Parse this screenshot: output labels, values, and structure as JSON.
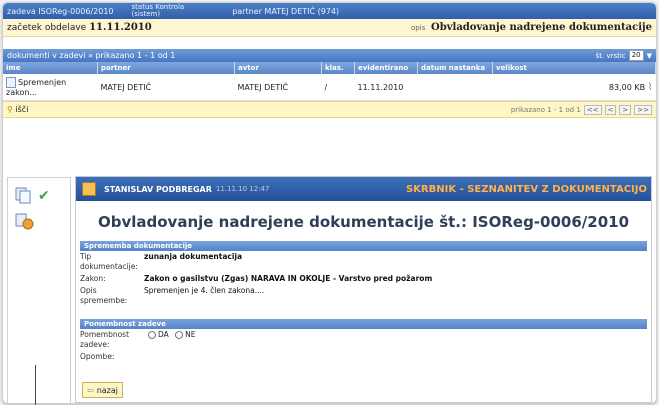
{
  "topbar": {
    "record": "zadeva ISOReg-0006/2010",
    "status_label": "status Kontrola",
    "status_value": "(sistem)",
    "partner": "partner MATEJ DETIČ (974)"
  },
  "title_row": {
    "start_label": "začetek obdelave",
    "start_date": "11.11.2010",
    "desc_label": "opis",
    "desc_value": "Obvladovanje nadrejene dokumentacije"
  },
  "list_header": {
    "title": "dokumenti v zadevi » prikazano 1 - 1 od 1",
    "rows_label": "št. vrstic",
    "rows_value": "20"
  },
  "columns": [
    "ime",
    "partner",
    "avtor",
    "klas.",
    "evidentirano",
    "datum nastanka",
    "velikost"
  ],
  "rows": [
    {
      "name_line1": "Spremenjen",
      "name_line2": "zakon...",
      "partner": "MATEJ DETIČ",
      "author": "MATEJ DETIČ",
      "klas": "/",
      "evidentirano": "11.11.2010",
      "datum": "",
      "size": "83,00 KB"
    }
  ],
  "filter": {
    "label": "išči",
    "pager_text": "prikazano 1 - 1 od 1",
    "buttons": [
      "<<",
      "<",
      ">",
      ">>"
    ]
  },
  "panel": {
    "author": "STANISLAV PODBREGAR",
    "time": "11.11.10 12:47",
    "header_title": "SKRBNIK - SEZNANITEV Z DOKUMENTACIJO",
    "big_title": "Obvladovanje nadrejene dokumentacije št.: ISOReg-0006/2010",
    "section1": "Sprememba dokumentacije",
    "fields": [
      {
        "label": "Tip dokumentacije:",
        "value": "zunanja dokumentacija",
        "bold": true
      },
      {
        "label": "Zakon:",
        "value": "Zakon o gasilstvu (Zgas) NARAVA IN OKOLJE - Varstvo pred požarom",
        "bold": true
      },
      {
        "label": "Opis spremembe:",
        "value": "Spremenjen je 4. člen zakona....",
        "bold": false
      }
    ],
    "section2": "Pomembnost zadeve",
    "importance_label": "Pomembnost zadeve:",
    "opt_yes": "DA",
    "opt_no": "NE",
    "notes_label": "Opombe:",
    "back_label": "nazaj"
  },
  "colors": {
    "accent": "#2f5fa8",
    "highlight": "#fff5d0",
    "orange": "#ffb24a"
  }
}
